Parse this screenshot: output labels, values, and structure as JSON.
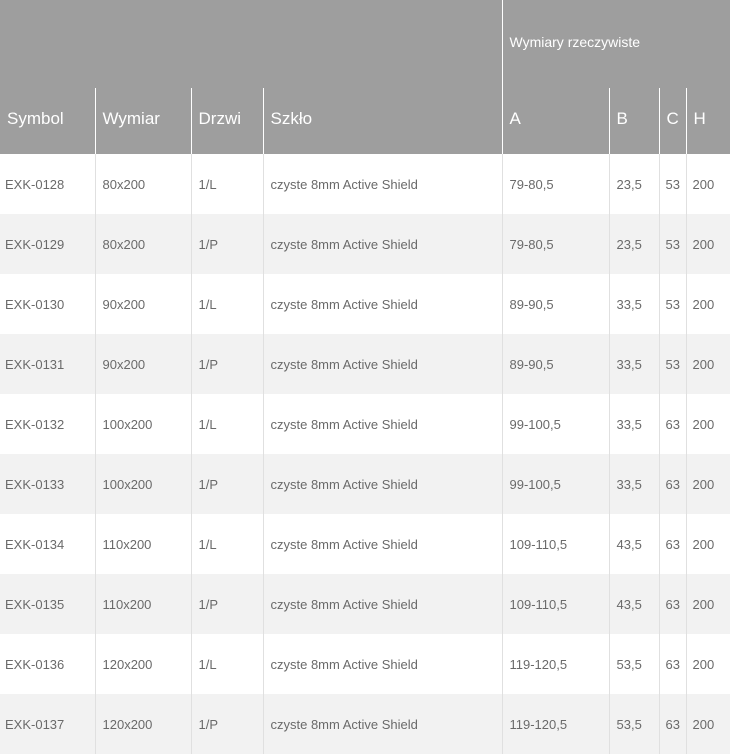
{
  "table": {
    "group_header": "Wymiary rzeczywiste",
    "columns": [
      "Symbol",
      "Wymiar",
      "Drzwi",
      "Szkło",
      "A",
      "B",
      "C",
      "H"
    ],
    "rows": [
      [
        "EXK-0128",
        "80x200",
        "1/L",
        "czyste 8mm Active Shield",
        "79-80,5",
        "23,5",
        "53",
        "200"
      ],
      [
        "EXK-0129",
        "80x200",
        "1/P",
        "czyste 8mm Active Shield",
        "79-80,5",
        "23,5",
        "53",
        "200"
      ],
      [
        "EXK-0130",
        "90x200",
        "1/L",
        "czyste 8mm Active Shield",
        "89-90,5",
        "33,5",
        "53",
        "200"
      ],
      [
        "EXK-0131",
        "90x200",
        "1/P",
        "czyste 8mm Active Shield",
        "89-90,5",
        "33,5",
        "53",
        "200"
      ],
      [
        "EXK-0132",
        "100x200",
        "1/L",
        "czyste 8mm Active Shield",
        "99-100,5",
        "33,5",
        "63",
        "200"
      ],
      [
        "EXK-0133",
        "100x200",
        "1/P",
        "czyste 8mm Active Shield",
        "99-100,5",
        "33,5",
        "63",
        "200"
      ],
      [
        "EXK-0134",
        "110x200",
        "1/L",
        "czyste 8mm Active Shield",
        "109-110,5",
        "43,5",
        "63",
        "200"
      ],
      [
        "EXK-0135",
        "110x200",
        "1/P",
        "czyste 8mm Active Shield",
        "109-110,5",
        "43,5",
        "63",
        "200"
      ],
      [
        "EXK-0136",
        "120x200",
        "1/L",
        "czyste 8mm Active Shield",
        "119-120,5",
        "53,5",
        "63",
        "200"
      ],
      [
        "EXK-0137",
        "120x200",
        "1/P",
        "czyste 8mm Active Shield",
        "119-120,5",
        "53,5",
        "63",
        "200"
      ]
    ]
  },
  "colors": {
    "header_bg": "#9e9e9e",
    "header_text": "#ffffff",
    "row_alt_bg": "#f2f2f2",
    "cell_text": "#6a6a6a"
  }
}
